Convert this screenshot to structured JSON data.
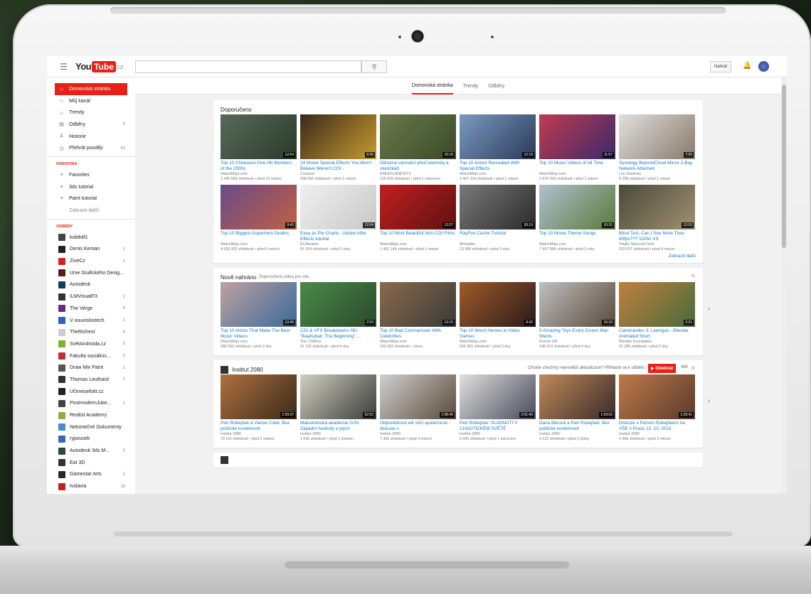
{
  "masthead": {
    "logo_you": "You",
    "logo_tube": "Tube",
    "logo_region": "CZ",
    "search_placeholder": "",
    "upload_label": "Nahrát"
  },
  "tabs": [
    {
      "label": "Domovská stránka",
      "active": true
    },
    {
      "label": "Trendy"
    },
    {
      "label": "Odběry"
    }
  ],
  "sidebar": {
    "nav": [
      {
        "label": "Domovská stránka",
        "icon": "home-icon",
        "active": true
      },
      {
        "label": "Můj kanál",
        "icon": "account-icon"
      },
      {
        "label": "Trendy",
        "icon": "flame-icon"
      },
      {
        "label": "Odběry",
        "icon": "subscriptions-icon",
        "count": "5"
      },
      {
        "label": "Historie",
        "icon": "history-icon"
      },
      {
        "label": "Přehrát později",
        "icon": "watch-later-icon",
        "count": "41"
      }
    ],
    "library_heading": "KNIHOVNA",
    "library": [
      {
        "label": "Favorites"
      },
      {
        "label": "3ds tutorial"
      },
      {
        "label": "Paint tutorial"
      }
    ],
    "show_more": "Zobrazit další",
    "subs_heading": "ODBĚRY",
    "subs": [
      {
        "label": "kolektif1",
        "count": "",
        "color": "#444444"
      },
      {
        "label": "Denis Keman",
        "count": "1",
        "color": "#222222"
      },
      {
        "label": "ZiveCz",
        "count": "1",
        "color": "#d62020"
      },
      {
        "label": "Unie Grafického Desig...",
        "count": "",
        "color": "#5a1a1a"
      },
      {
        "label": "Autodesk",
        "count": "",
        "color": "#1a3a5a"
      },
      {
        "label": "ILMVisualFX",
        "count": "2",
        "color": "#333333"
      },
      {
        "label": "The Verge",
        "count": "4",
        "color": "#6a2a8a"
      },
      {
        "label": "V souvislostech",
        "count": "1",
        "color": "#3060c0"
      },
      {
        "label": "TheRichest",
        "count": "9",
        "color": "#cccccc"
      },
      {
        "label": "SvětAndroida.cz",
        "count": "3",
        "color": "#7fb030"
      },
      {
        "label": "Fakulta sociálníc...",
        "count": "3",
        "color": "#c03030"
      },
      {
        "label": "Draw Mix Paint",
        "count": "2",
        "color": "#555555"
      },
      {
        "label": "Thomas Leuthard",
        "count": "1",
        "color": "#333333"
      },
      {
        "label": "Učimesefotit.cz",
        "count": "",
        "color": "#222222"
      },
      {
        "label": "PostmodernJuke...",
        "count": "1",
        "color": "#444444"
      },
      {
        "label": "Realist Academy",
        "count": "",
        "color": "#8ab040"
      },
      {
        "label": "Nekonečné Dokumenty",
        "count": "",
        "color": "#4a8ad0"
      },
      {
        "label": "rypousek",
        "count": "",
        "color": "#3a6ab0"
      },
      {
        "label": "Autodesk 3ds M...",
        "count": "5",
        "color": "#2a4a3a"
      },
      {
        "label": "Eat 3D",
        "count": "",
        "color": "#333333"
      },
      {
        "label": "Gamestar Arts",
        "count": "2",
        "color": "#2a2a2a"
      },
      {
        "label": "tvslavia",
        "count": "19",
        "color": "#c02020"
      }
    ]
  },
  "shelves": {
    "recommended": {
      "title": "Doporučeno",
      "show_more": "Zobrazit další",
      "videos": [
        {
          "title": "Top 10 Cheesiest One-Hit Wonders of the 2000s",
          "channel": "WatchMojo.com",
          "meta": "2 445 684 zhlédnutí • před 10 měsíci",
          "dur": "12:54",
          "c1": "#5a6a5a",
          "c2": "#2a3a2a"
        },
        {
          "title": "14 Movie Special Effects You Won't Believe Weren't CGI -",
          "channel": "Cracked",
          "meta": "598 550 zhlédnutí • před 1 rokem",
          "dur": "8:35",
          "c1": "#3a2a1a",
          "c2": "#c89a30"
        },
        {
          "title": "Důrazné varování před islamisty a sluníčkáři",
          "channel": "FREEPLANETeTV",
          "meta": "125 025 zhlédnutí • před 1 měsícem",
          "dur": "16:18",
          "c1": "#6a7a4a",
          "c2": "#3a4a2a"
        },
        {
          "title": "Top 10 Actors Recreated With Special Effects",
          "channel": "WatchMojo.com",
          "meta": "3 467 314 zhlédnutí • před 1 rokem",
          "dur": "12:18",
          "c1": "#7a9ac0",
          "c2": "#2a3a5a"
        },
        {
          "title": "Top 10 Music Videos of All Time",
          "channel": "WatchMojo.com",
          "meta": "2 570 993 zhlédnutí • před 1 rokem",
          "dur": "11:57",
          "c1": "#c03a50",
          "c2": "#3a2a6a"
        },
        {
          "title": "Synology BeyondCloud Mirror 2-Bay Network Attached",
          "channel": "Lon Seidman",
          "meta": "8 258 zhlédnutí • před 1 rokem",
          "dur": "7:05",
          "c1": "#e0e0e0",
          "c2": "#8a7a6a"
        },
        {
          "title": "Top 10 Biggest Superhero Deaths",
          "channel": "WatchMojo.com",
          "meta": "4 925 302 zhlédnutí • před 6 měsíci",
          "dur": "9:43",
          "c1": "#6a4a8a",
          "c2": "#c06040"
        },
        {
          "title": "Easy as Pie Charts - Adobe After Effects tutorial",
          "channel": "ECAbrams",
          "meta": "66 264 zhlédnutí • před 2 roky",
          "dur": "12:04",
          "c1": "#f0f0f0",
          "c2": "#c8c8c8"
        },
        {
          "title": "Top 10 Most Beautiful Non-CGI Films",
          "channel": "WatchMojo.com",
          "meta": "1 461 144 zhlédnutí • před 1 rokem",
          "dur": "13:27",
          "c1": "#c02020",
          "c2": "#601010"
        },
        {
          "title": "RayFire Cache Tutorial",
          "channel": "MirVadim",
          "meta": "23 996 zhlédnutí • před 3 roky",
          "dur": "30:19",
          "c1": "#7a7a7a",
          "c2": "#2a2a2a"
        },
        {
          "title": "Top 10 Movie Theme Songs",
          "channel": "WatchMojo.com",
          "meta": "7 497 898 zhlédnutí • před 2 roky",
          "dur": "10:31",
          "c1": "#b0c0d0",
          "c2": "#5a7a3a"
        },
        {
          "title": "Blind Test, Can I See More Than 60fps??? 120hz VS",
          "channel": "Totally Silenced Tech",
          "meta": "323 037 zhlédnutí • před 4 měsíci",
          "dur": "12:03",
          "c1": "#4a4a3a",
          "c2": "#a09070"
        }
      ]
    },
    "new": {
      "title": "Nově nahráno",
      "subtitle": "Doporučená videa pro vás",
      "videos": [
        {
          "title": "Top 10 Artists That Make The Best Music Videos",
          "channel": "WatchMojo.com",
          "meta": "289 550 zhlédnutí • před 2 dny",
          "dur": "13:49",
          "c1": "#c0a0a0",
          "c2": "#3a6a9a"
        },
        {
          "title": "CGI & VFX Breakdowns HD: \"Baahubali: The Beginning\" ...",
          "channel": "The CGBros",
          "meta": "11 732 zhlédnutí • před 4 dny",
          "dur": "2:53",
          "c1": "#4a8a4a",
          "c2": "#2a4a2a"
        },
        {
          "title": "Top 10 Bad Commercials With Celebrities",
          "channel": "WatchMojo.com",
          "meta": "193 393 zhlédnutí • včera",
          "dur": "13:15",
          "c1": "#8a6a4a",
          "c2": "#3a3a3a"
        },
        {
          "title": "Top 10 Worst Heroes in Video Games",
          "channel": "WatchMojo.com",
          "meta": "525 361 zhlédnutí • před 3 dny",
          "dur": "9:42",
          "c1": "#a05a2a",
          "c2": "#2a1a1a"
        },
        {
          "title": "5 Amazing Toys Every Grown Man Wants",
          "channel": "Freeze HD",
          "meta": "108 210 zhlédnutí • před 4 dny",
          "dur": "10:33",
          "c1": "#c0c0c0",
          "c2": "#5a4a3a"
        },
        {
          "title": "Caminandes 3: Llamigos - Blender Animated Short",
          "channel": "Blender Foundation",
          "meta": "52 285 zhlédnutí • před 5 dny",
          "dur": "2:31",
          "c1": "#c08040",
          "c2": "#4a6a3a"
        }
      ]
    },
    "channel": {
      "title": "Institut 2080",
      "sub_prompt": "Chcete všechny nejnovější aktualizace? Přihlaste se k odběru.",
      "sub_label": "Odebírat",
      "sub_count": "480",
      "videos": [
        {
          "title": "Petr Robejšek a Václav Cílek: Bez politické korektnosti",
          "channel": "Institut 2080",
          "meta": "19 115 zhlédnutí • před 2 měsíci",
          "dur": "1:59:37",
          "c1": "#b07040",
          "c2": "#3a2a1a"
        },
        {
          "title": "Malostranská akademie GJN: Západní hodnoty a jejich",
          "channel": "Institut 2080",
          "meta": "1 035 zhlédnutí • před 1 týdnem",
          "dur": "52:52",
          "c1": "#d0d0c0",
          "c2": "#3a3a3a"
        },
        {
          "title": "Odpovědnost elit vůči společnosti - diskuse s",
          "channel": "Institut 2080",
          "meta": "7 306 zhlédnutí • před 3 měsíci",
          "dur": "1:08:40",
          "c1": "#d0d0d0",
          "c2": "#5a4a3a"
        },
        {
          "title": "Petr Robejšek: VLÁDNUTÍ V CHAOTICKÉM SVĚTĚ",
          "channel": "Institut 2080",
          "meta": "5 996 zhlédnutí • před 1 měsícem",
          "dur": "2:01:40",
          "c1": "#e0e0e0",
          "c2": "#4a4a5a"
        },
        {
          "title": "Dana Bérová a Petr Robejšek: Bez politické korektnosti",
          "channel": "Institut 2080",
          "meta": "4 122 zhlédnutí • před 2 týdny",
          "dur": "1:59:02",
          "c1": "#c08a5a",
          "c2": "#3a2a2a"
        },
        {
          "title": "Diskuze s Petrem Robejškem na VŠE v Praze 13. 10. 2015",
          "channel": "Institut 2080",
          "meta": "4 306 zhlédnutí • před 3 měsíci",
          "dur": "1:29:41",
          "c1": "#c07a4a",
          "c2": "#5a3a2a"
        }
      ]
    }
  }
}
